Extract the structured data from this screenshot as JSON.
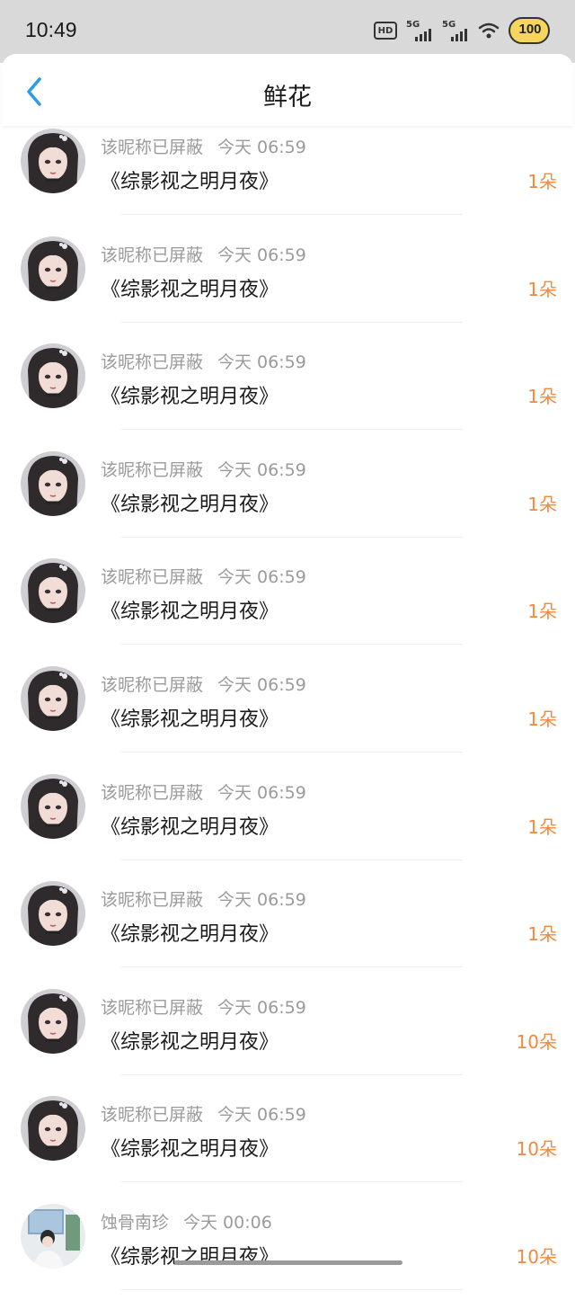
{
  "status_bar": {
    "time": "10:49",
    "hd_label": "HD",
    "signal1_label": "5G",
    "signal2_label": "5G",
    "battery_level": "100"
  },
  "header": {
    "back_icon": "chevron-left-icon",
    "title": "鲜花"
  },
  "colors": {
    "accent_blue": "#2a9ce8",
    "count_orange": "#f08a3e",
    "muted_text": "#9b9b9b"
  },
  "flowers": [
    {
      "nickname": "该昵称已屏蔽",
      "time": "今天 06:59",
      "book": "《综影视之明月夜》",
      "count": "1朵"
    },
    {
      "nickname": "该昵称已屏蔽",
      "time": "今天 06:59",
      "book": "《综影视之明月夜》",
      "count": "1朵"
    },
    {
      "nickname": "该昵称已屏蔽",
      "time": "今天 06:59",
      "book": "《综影视之明月夜》",
      "count": "1朵"
    },
    {
      "nickname": "该昵称已屏蔽",
      "time": "今天 06:59",
      "book": "《综影视之明月夜》",
      "count": "1朵"
    },
    {
      "nickname": "该昵称已屏蔽",
      "time": "今天 06:59",
      "book": "《综影视之明月夜》",
      "count": "1朵"
    },
    {
      "nickname": "该昵称已屏蔽",
      "time": "今天 06:59",
      "book": "《综影视之明月夜》",
      "count": "1朵"
    },
    {
      "nickname": "该昵称已屏蔽",
      "time": "今天 06:59",
      "book": "《综影视之明月夜》",
      "count": "1朵"
    },
    {
      "nickname": "该昵称已屏蔽",
      "time": "今天 06:59",
      "book": "《综影视之明月夜》",
      "count": "1朵"
    },
    {
      "nickname": "该昵称已屏蔽",
      "time": "今天 06:59",
      "book": "《综影视之明月夜》",
      "count": "10朵"
    },
    {
      "nickname": "该昵称已屏蔽",
      "time": "今天 06:59",
      "book": "《综影视之明月夜》",
      "count": "10朵"
    },
    {
      "nickname": "蚀骨南珍",
      "time": "今天 00:06",
      "book": "《综影视之明月夜》",
      "count": "10朵"
    }
  ]
}
